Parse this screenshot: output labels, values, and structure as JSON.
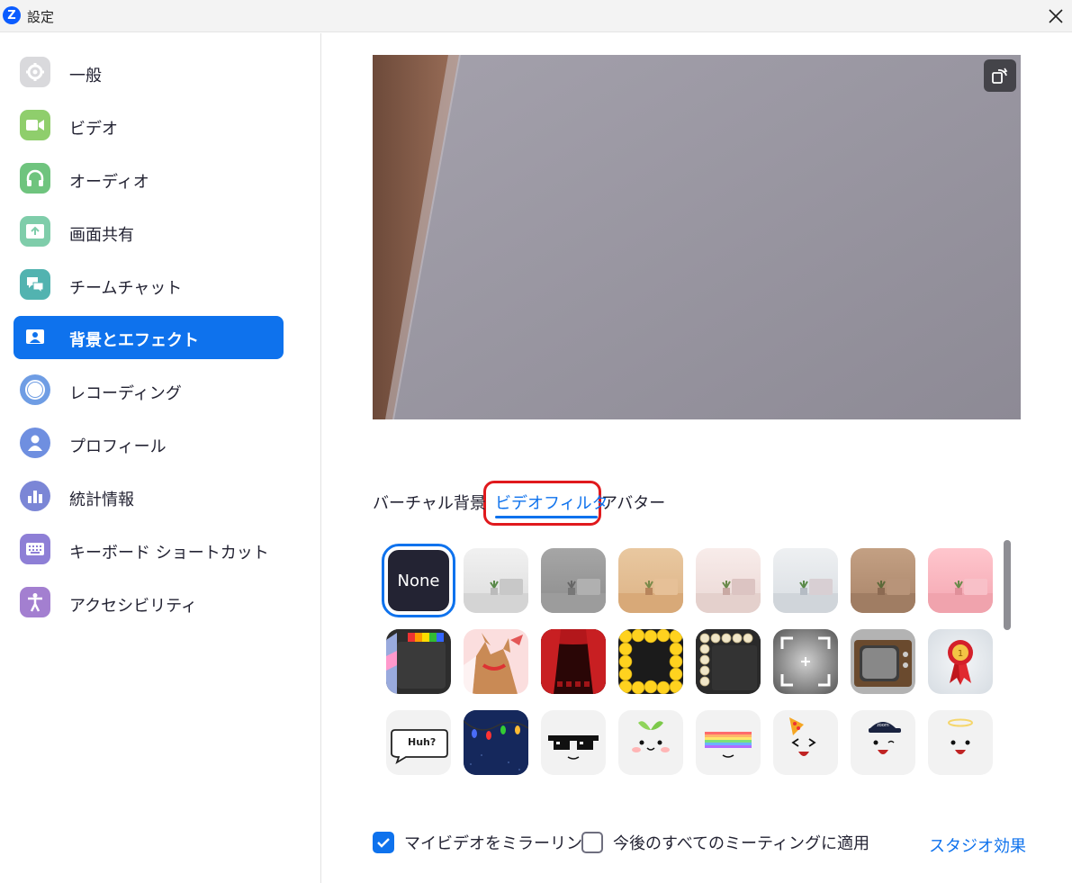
{
  "window": {
    "title": "設定",
    "logo_letter": "Z"
  },
  "sidebar": {
    "items": [
      {
        "label": "一般",
        "icon": "gear-icon",
        "color": "#d9d9dc"
      },
      {
        "label": "ビデオ",
        "icon": "video-camera-icon",
        "color": "#8fce6c"
      },
      {
        "label": "オーディオ",
        "icon": "headphones-icon",
        "color": "#6fc47e"
      },
      {
        "label": "画面共有",
        "icon": "share-screen-icon",
        "color": "#7fcdaa"
      },
      {
        "label": "チームチャット",
        "icon": "chat-bubbles-icon",
        "color": "#52b3b0"
      },
      {
        "label": "背景とエフェクト",
        "icon": "background-person-icon",
        "color": "#0e72ed",
        "active": true
      },
      {
        "label": "レコーディング",
        "icon": "record-icon",
        "color": "#6f9de4"
      },
      {
        "label": "プロフィール",
        "icon": "profile-icon",
        "color": "#6f8fe0"
      },
      {
        "label": "統計情報",
        "icon": "statistics-icon",
        "color": "#7b86d6"
      },
      {
        "label": "キーボード ショートカット",
        "icon": "keyboard-icon",
        "color": "#8e7fd6"
      },
      {
        "label": "アクセシビリティ",
        "icon": "accessibility-icon",
        "color": "#a37fd0"
      }
    ]
  },
  "tabs": [
    {
      "label": "バーチャル背景",
      "active": false
    },
    {
      "label": "ビデオフィルタ",
      "active": true
    },
    {
      "label": "アバター",
      "active": false
    }
  ],
  "filters": {
    "none_label": "None",
    "huh_label": "Huh?",
    "items": [
      "none",
      "room-white",
      "room-gray",
      "room-tan",
      "room-pink-light",
      "room-light-gray",
      "room-brown",
      "room-pink",
      "pride-frame",
      "corgi",
      "theater-curtains",
      "emoji-frame",
      "marquee-lights",
      "camera-focus-frame",
      "retro-tv",
      "award-ribbon",
      "speech-bubble",
      "christmas-lights",
      "pixel-sunglasses",
      "sprout",
      "rainbow-halo",
      "party-hat",
      "zoom-cap",
      "angel-halo"
    ]
  },
  "controls": {
    "mirror_label": "マイビデオをミラーリング",
    "mirror_checked": true,
    "apply_all_label": "今後のすべてのミーティングに適用",
    "apply_all_checked": false,
    "studio_link": "スタジオ効果"
  }
}
